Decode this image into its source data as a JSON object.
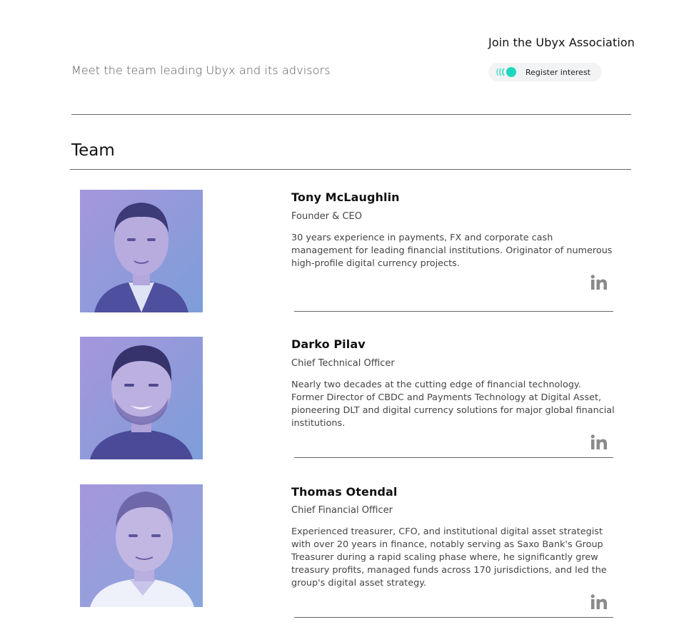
{
  "header": {
    "subtitle": "Meet the team leading Ubyx and its advisors",
    "join_title": "Join the Ubyx Association",
    "register_label": "Register interest",
    "register_icon": "signal-waves-icon"
  },
  "section": {
    "title": "Team"
  },
  "colors": {
    "accent": "#1ed6c0",
    "photo_tint_top": "#9b8fd6",
    "photo_tint_bottom": "#7f9fd8"
  },
  "team": [
    {
      "name": "Tony McLaughlin",
      "role": "Founder & CEO",
      "bio": "30 years experience in payments, FX and corporate cash management for leading financial institutions. Originator of numerous high-profile digital currency projects.",
      "social_icon": "linkedin-icon"
    },
    {
      "name": "Darko Pilav",
      "role": "Chief Technical Officer",
      "bio": "Nearly two decades at the cutting edge of financial technology. Former Director of CBDC and Payments Technology at Digital Asset, pioneering DLT and digital currency solutions for major global financial institutions.",
      "social_icon": "linkedin-icon"
    },
    {
      "name": "Thomas Otendal",
      "role": "Chief Financial Officer",
      "bio": "Experienced treasurer, CFO, and institutional digital asset strategist with over 20 years in finance, notably serving as Saxo Bank's Group Treasurer during a rapid scaling phase where, he significantly grew treasury profits, managed funds across 170 jurisdictions, and led the group's digital asset strategy.",
      "social_icon": "linkedin-icon"
    }
  ]
}
